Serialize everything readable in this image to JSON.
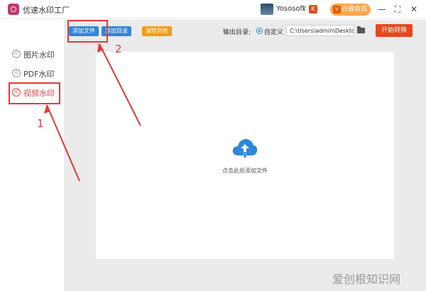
{
  "titlebar": {
    "app_title": "优速水印工厂",
    "username": "Yososoft",
    "dropdown_glyph": "∨",
    "badge_glyph": "K",
    "vip_label": "开通会员",
    "vip_icon_glyph": "V",
    "minimize_glyph": "—",
    "maximize_glyph": "⛶",
    "close_glyph": "✕"
  },
  "sidebar": {
    "items": [
      {
        "label": "图片水印",
        "icon_glyph": "印",
        "active": false
      },
      {
        "label": "PDF水印",
        "icon_glyph": "印",
        "active": false
      },
      {
        "label": "视频水印",
        "icon_glyph": "印",
        "active": true
      }
    ],
    "icon_name": "seal-icon"
  },
  "toolbar": {
    "add_file_label": "添加文件",
    "add_dir_label": "添加目录",
    "clear_label": "清除列表",
    "output_label": "输出目录:",
    "radio_label": "自定义",
    "path_value": "C:\\Users\\admin\\Deskto",
    "start_label": "开始转换"
  },
  "dropzone": {
    "hint": "点击此处添加文件",
    "icon_name": "cloud-upload-icon",
    "icon_color": "#2f87d8"
  },
  "annotations": {
    "num_1": "1",
    "num_2": "2",
    "color": "#e53935"
  },
  "watermark": "爱创根知识网",
  "colors": {
    "accent_blue": "#2f87d8",
    "clear_orange": "#f39c12",
    "start_red": "#e8461e",
    "active_red": "#e64545"
  }
}
